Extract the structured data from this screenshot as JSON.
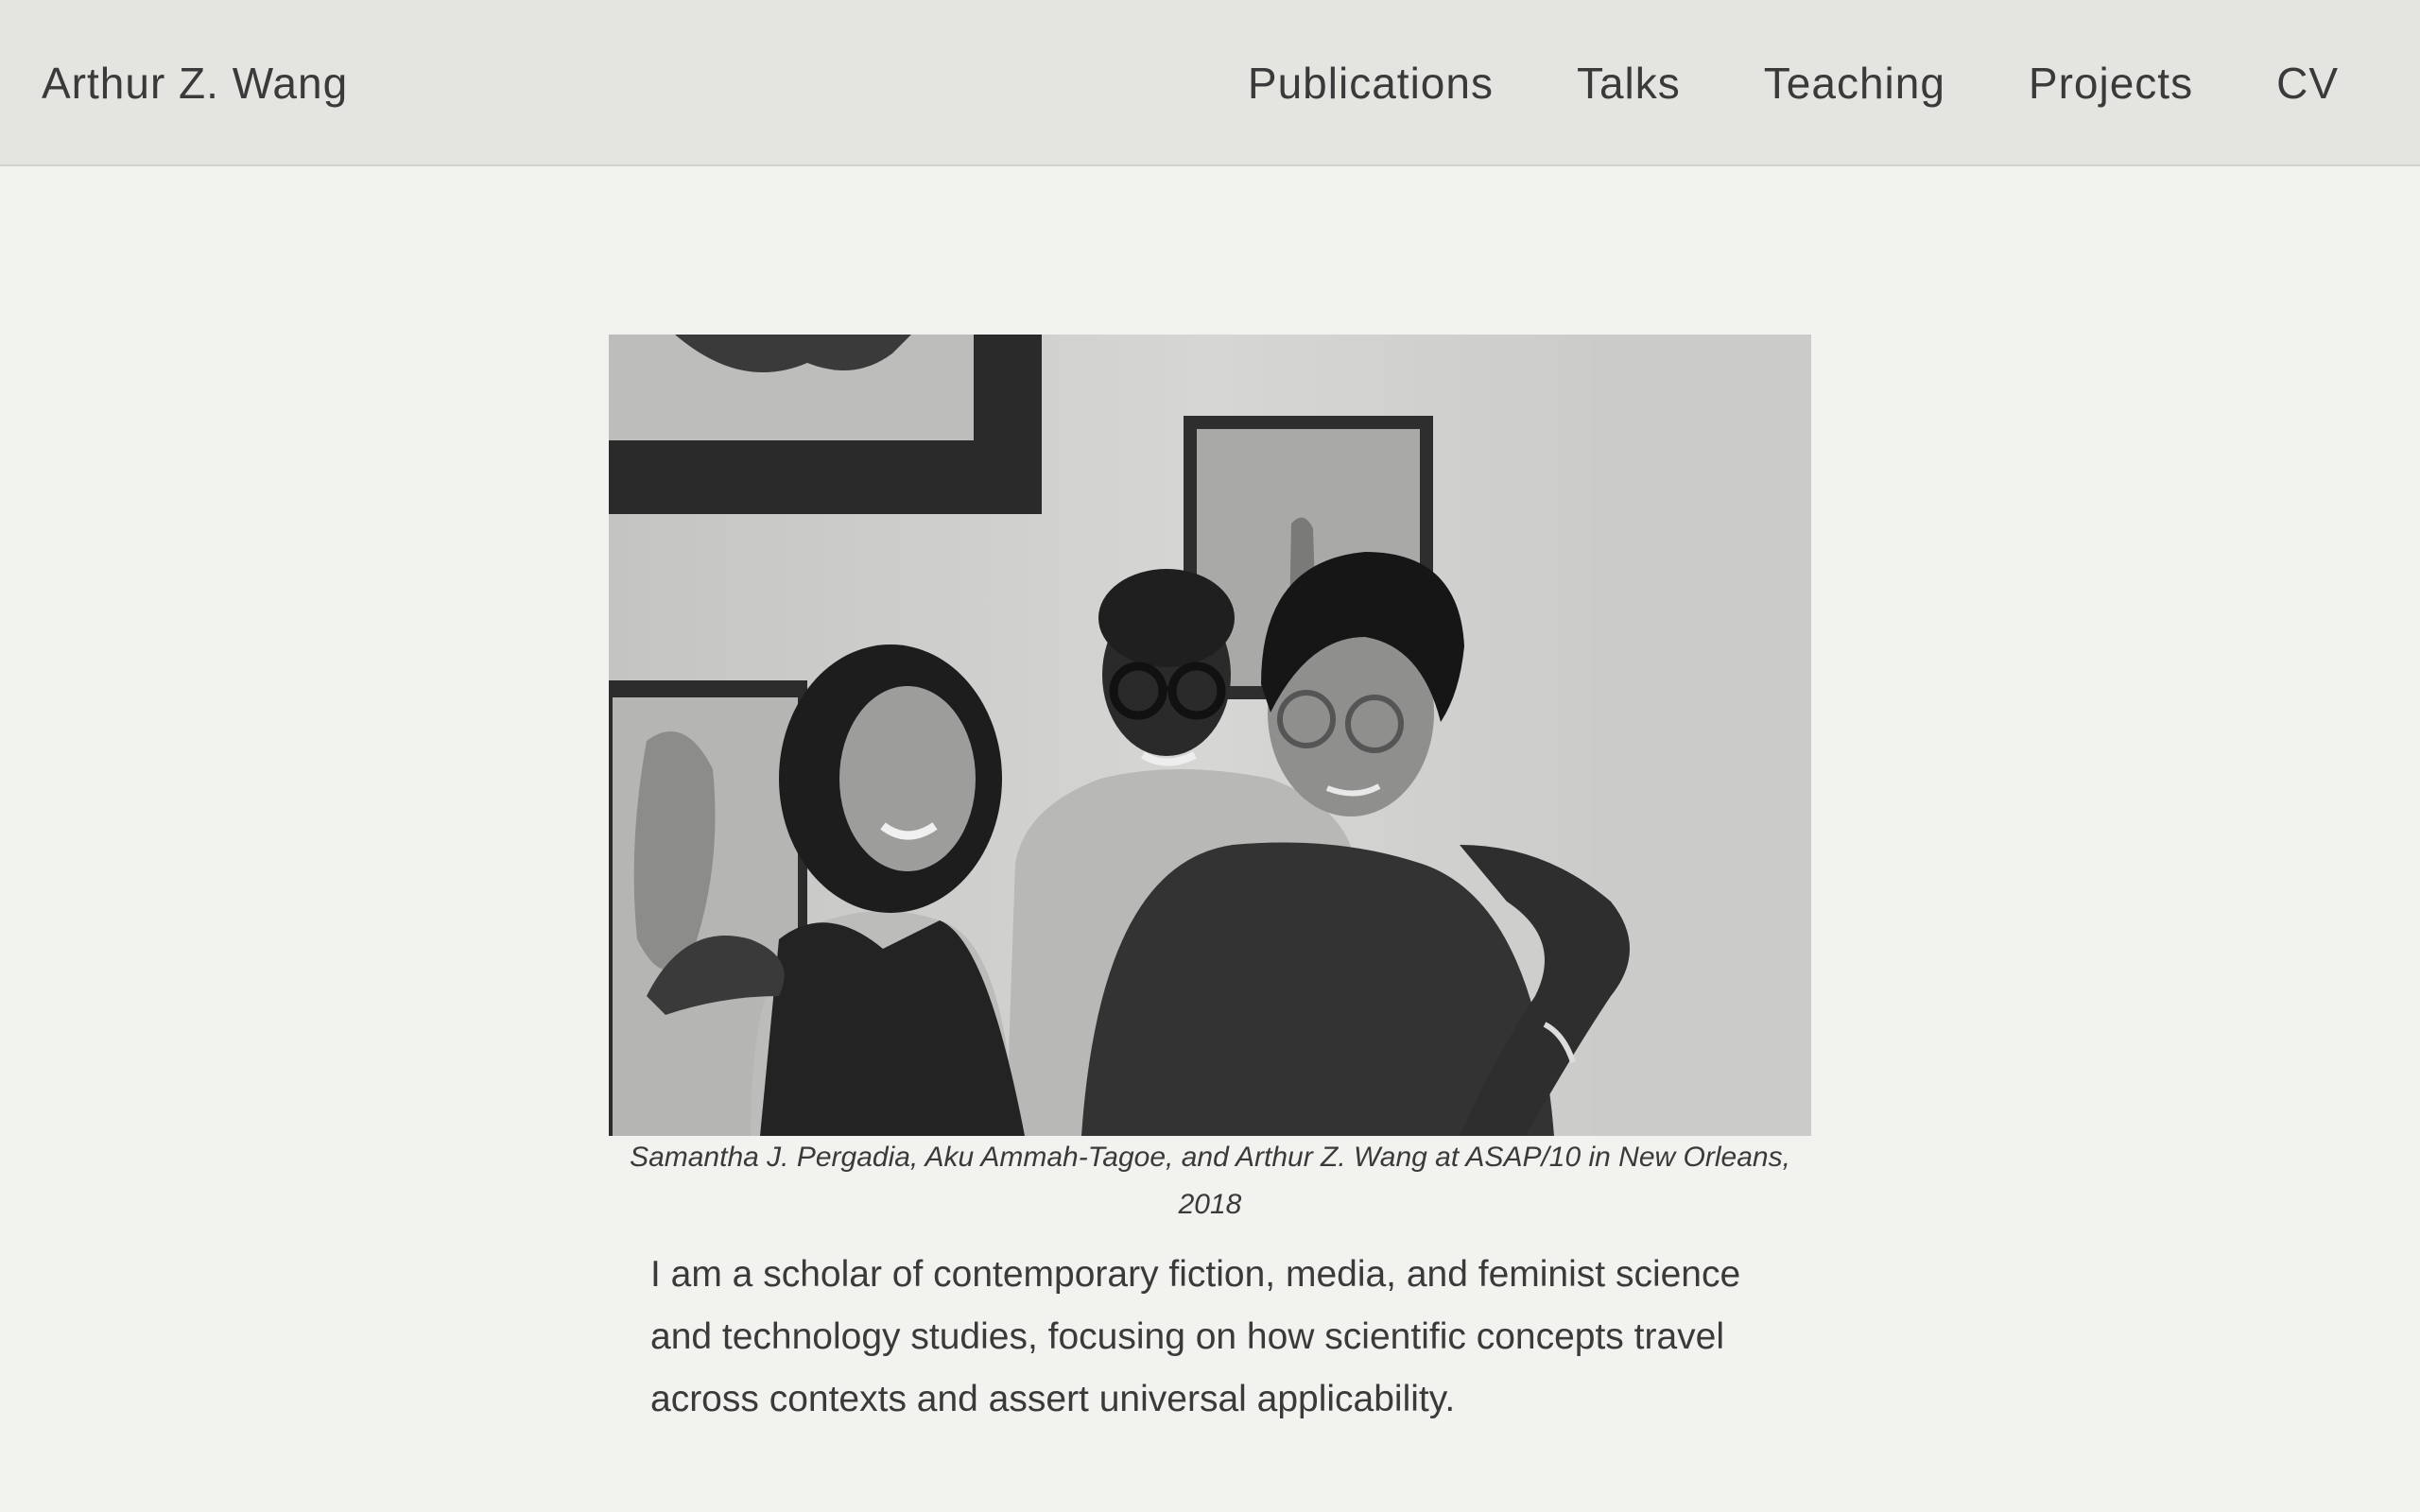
{
  "header": {
    "site_title": "Arthur Z. Wang",
    "nav": [
      "Publications",
      "Talks",
      "Teaching",
      "Projects",
      "CV"
    ]
  },
  "main": {
    "photo_alt": "Samantha J. Pergadia, Aku Ammah-Tagoe, and Arthur Z. Wang at ASAP/10 in New Orleans, 2018",
    "caption": "Samantha J. Pergadia, Aku Ammah-Tagoe, and Arthur Z. Wang at ASAP/10 in New Orleans, 2018",
    "bio": "I am a scholar of contemporary fiction, media, and feminist science and technology studies, focusing on how scientific concepts travel across contexts and assert universal applicability."
  },
  "colors": {
    "page_background": "#f2f2ef",
    "header_background": "#e4e4e1",
    "text": "#3a3a3a"
  }
}
